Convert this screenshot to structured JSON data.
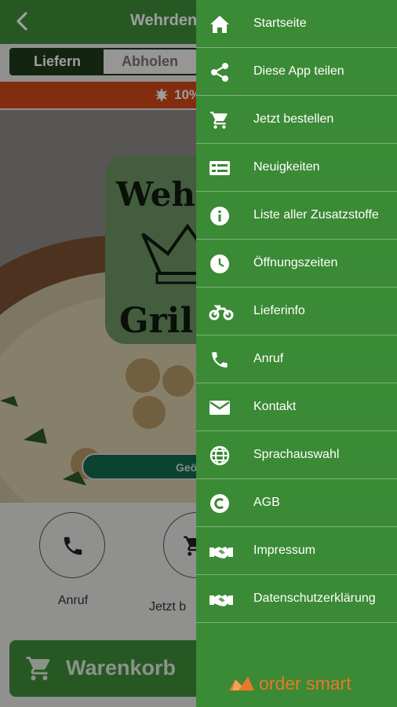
{
  "header": {
    "title": "Wehrdene"
  },
  "tabs": {
    "deliver": "Liefern",
    "pickup": "Abholen"
  },
  "promo": {
    "text": "10%"
  },
  "hero": {
    "logo_text_top": "Weh",
    "logo_text_bottom": "Gril",
    "opening_pill": "Geö"
  },
  "actions": {
    "call": "Anruf",
    "order": "Jetzt b"
  },
  "cart": {
    "label": "Warenkorb"
  },
  "drawer": {
    "items": [
      {
        "label": "Startseite",
        "icon": "home-icon"
      },
      {
        "label": "Diese App teilen",
        "icon": "share-icon"
      },
      {
        "label": "Jetzt bestellen",
        "icon": "cart-icon"
      },
      {
        "label": "Neuigkeiten",
        "icon": "news-icon"
      },
      {
        "label": "Liste aller Zusatzstoffe",
        "icon": "info-icon"
      },
      {
        "label": "Öffnungszeiten",
        "icon": "clock-icon"
      },
      {
        "label": "Lieferinfo",
        "icon": "motorbike-icon"
      },
      {
        "label": "Anruf",
        "icon": "phone-icon"
      },
      {
        "label": "Kontakt",
        "icon": "mail-icon"
      },
      {
        "label": "Sprachauswahl",
        "icon": "globe-icon"
      },
      {
        "label": "AGB",
        "icon": "copyright-icon"
      },
      {
        "label": "Impressum",
        "icon": "handshake-icon"
      },
      {
        "label": "Datenschutzerklärung",
        "icon": "handshake-icon"
      }
    ],
    "brand": "order smart"
  },
  "colors": {
    "primary_green": "#3f8f3a",
    "drawer_green": "#3b8a35",
    "promo_orange": "#d4491b",
    "brand_orange": "#e8792a"
  }
}
